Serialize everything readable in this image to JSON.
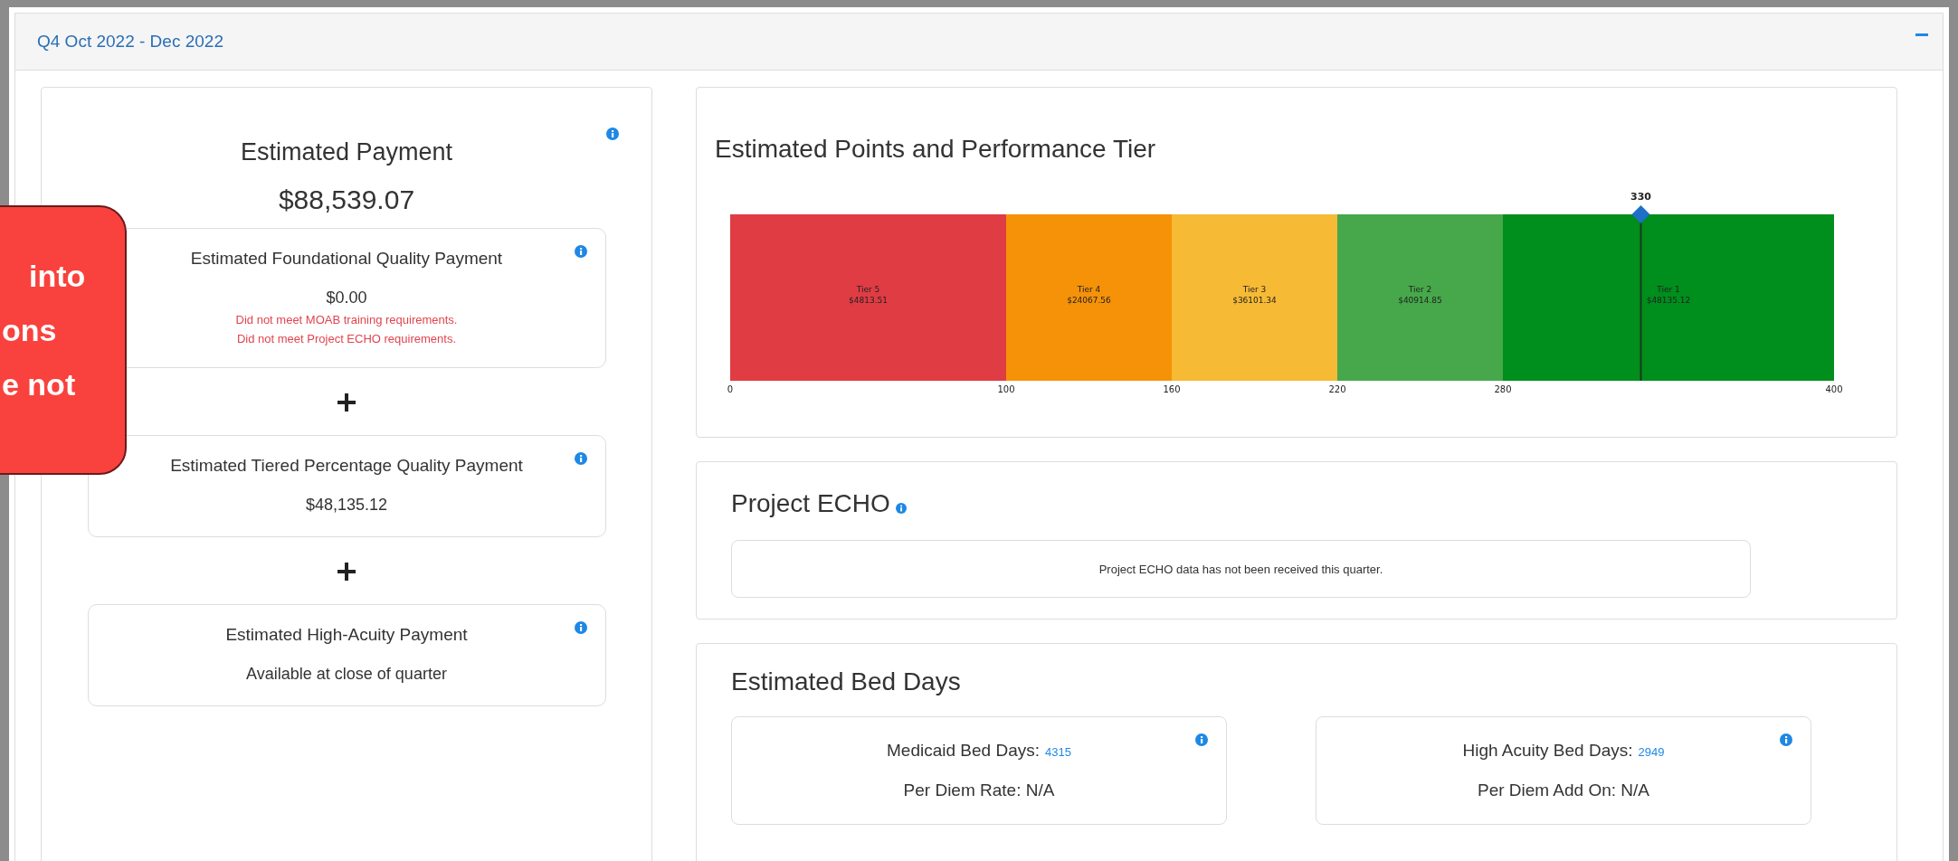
{
  "panel": {
    "title": "Q4 Oct 2022 - Dec 2022",
    "expanded": true
  },
  "payment": {
    "title": "Estimated Payment",
    "amount": "$88,539.07",
    "cards": [
      {
        "title": "Estimated Foundational Quality Payment",
        "value": "$0.00",
        "notes": [
          "Did not meet MOAB training requirements.",
          "Did not meet Project ECHO requirements."
        ]
      },
      {
        "title": "Estimated Tiered Percentage Quality Payment",
        "value": "$48,135.12"
      },
      {
        "title": "Estimated High-Acuity Payment",
        "value": "Available at close of quarter"
      }
    ]
  },
  "tier_chart": {
    "title": "Estimated Points and Performance Tier",
    "chart_data": {
      "type": "bar",
      "orientation": "horizontal",
      "stacked": true,
      "xlim": [
        0,
        400
      ],
      "xticks": [
        0,
        100,
        160,
        220,
        280,
        400
      ],
      "series": [
        {
          "name": "Tier 5",
          "color": "#e03c43",
          "values": [
            100
          ]
        },
        {
          "name": "Tier 4",
          "color": "#f59208",
          "values": [
            60
          ]
        },
        {
          "name": "Tier 3",
          "color": "#f6ba34",
          "values": [
            60
          ]
        },
        {
          "name": "Tier 2",
          "color": "#46a84a",
          "values": [
            60
          ]
        },
        {
          "name": "Tier 1",
          "color": "#008e1c",
          "values": [
            120
          ]
        }
      ],
      "value_labels": [
        "$4813.51",
        "$24067.56",
        "$36101.34",
        "$40914.85",
        "$48135.12"
      ],
      "ref_lines": [
        {
          "axis": "x",
          "value": 330,
          "label": "330"
        }
      ]
    }
  },
  "project_echo": {
    "title": "Project ECHO",
    "message": "Project ECHO data has not been received this quarter."
  },
  "bed_days": {
    "title": "Estimated Bed Days",
    "cards": [
      {
        "label": "Medicaid Bed Days:",
        "value": "4315",
        "detail": "Per Diem Rate: N/A"
      },
      {
        "label": "High Acuity Bed Days:",
        "value": "2949",
        "detail": "Per Diem Add On: N/A"
      }
    ]
  },
  "callout": {
    "lines": [
      "into",
      "ons",
      "e not"
    ]
  }
}
